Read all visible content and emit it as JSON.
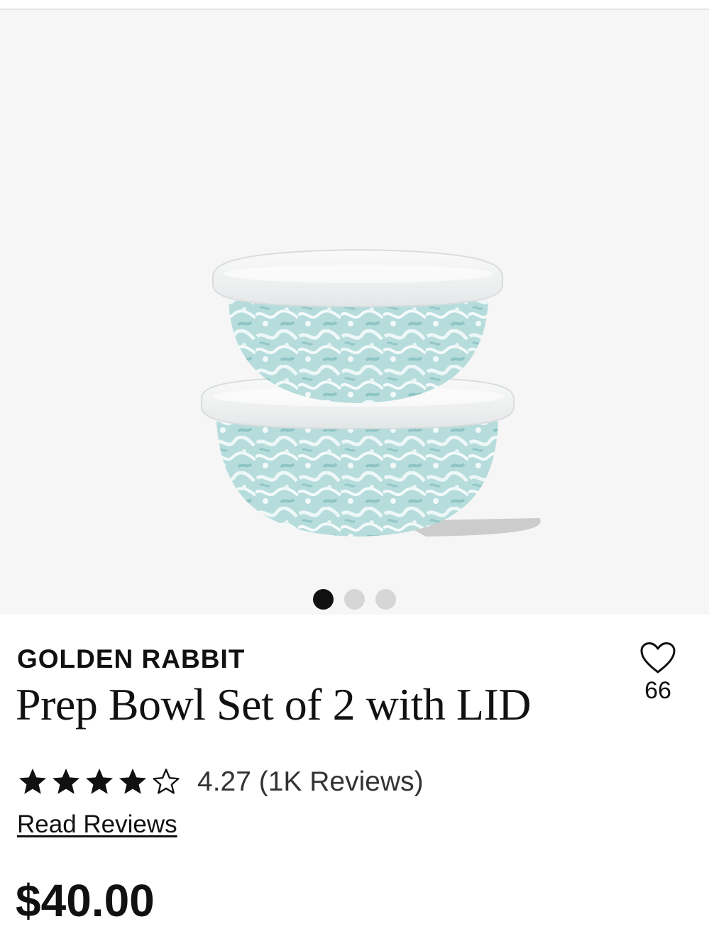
{
  "gallery": {
    "image_alt": "Prep bowl set of 2 with lids, sea-green swirl enamel",
    "dots": [
      {
        "name": "gallery-dot-1",
        "active": true
      },
      {
        "name": "gallery-dot-2",
        "active": false
      },
      {
        "name": "gallery-dot-3",
        "active": false
      }
    ],
    "colors": {
      "enamel": "#a9d3d3",
      "enamel_dark": "#8cc1c2",
      "lid": "#f1f3f4"
    }
  },
  "product": {
    "brand": "GOLDEN RABBIT",
    "title": "Prep Bowl Set of 2 with LID",
    "favorite_icon": "heart-outline-icon",
    "favorite_count": "66",
    "rating": {
      "value": 4.27,
      "stars_filled": 4,
      "stars_total": 5,
      "text": "4.27 (1K Reviews)"
    },
    "read_reviews_label": "Read Reviews",
    "price": "$40.00"
  }
}
